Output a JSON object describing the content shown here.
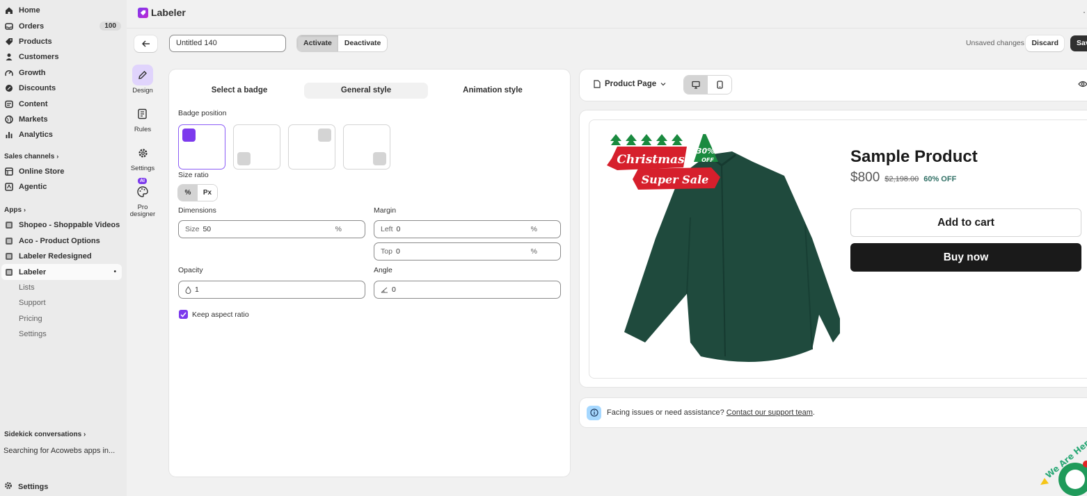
{
  "sidebar": {
    "items": [
      {
        "label": "Home",
        "icon": "home-icon"
      },
      {
        "label": "Orders",
        "icon": "orders-icon",
        "badge": "100"
      },
      {
        "label": "Products",
        "icon": "tag-icon"
      },
      {
        "label": "Customers",
        "icon": "person-icon"
      },
      {
        "label": "Growth",
        "icon": "growth-icon"
      },
      {
        "label": "Discounts",
        "icon": "discount-icon"
      },
      {
        "label": "Content",
        "icon": "content-icon"
      },
      {
        "label": "Markets",
        "icon": "globe-icon"
      },
      {
        "label": "Analytics",
        "icon": "chart-icon"
      }
    ],
    "sales_channels_label": "Sales channels",
    "channels": [
      {
        "label": "Online Store",
        "icon": "store-icon"
      },
      {
        "label": "Agentic",
        "icon": "agentic-icon"
      }
    ],
    "apps_label": "Apps",
    "apps": [
      {
        "label": "Shopeo - Shoppable Videos"
      },
      {
        "label": "Aco - Product Options"
      },
      {
        "label": "Labeler Redesigned"
      },
      {
        "label": "Labeler"
      }
    ],
    "labeler_sub": [
      "Lists",
      "Support",
      "Pricing",
      "Settings"
    ],
    "sidekick_title": "Sidekick conversations",
    "sidekick_item": "Searching for Acowebs apps in...",
    "settings_label": "Settings"
  },
  "header": {
    "app_title": "Labeler",
    "badge_name": "Untitled 140",
    "activate_label": "Activate",
    "deactivate_label": "Deactivate",
    "unsaved_label": "Unsaved changes",
    "discard_label": "Discard",
    "save_label": "Save"
  },
  "rail": {
    "design": "Design",
    "rules": "Rules",
    "settings": "Settings",
    "pro_line1": "Pro",
    "pro_line2": "designer",
    "ai_tag": "AI"
  },
  "editor": {
    "tabs": [
      "Select a badge",
      "General style",
      "Animation style"
    ],
    "selected_tab": 1,
    "badge_position_label": "Badge position",
    "size_ratio_label": "Size ratio",
    "size_ratio_options": [
      "%",
      "Px"
    ],
    "dimensions_label": "Dimensions",
    "size_prefix": "Size",
    "size_value": "50",
    "size_unit": "%",
    "margin_label": "Margin",
    "left_prefix": "Left",
    "left_value": "0",
    "top_prefix": "Top",
    "top_value": "0",
    "margin_unit": "%",
    "opacity_label": "Opacity",
    "opacity_value": "1",
    "angle_label": "Angle",
    "angle_value": "0",
    "keep_aspect_label": "Keep aspect ratio"
  },
  "preview": {
    "page_select": "Product Page",
    "badge_text": {
      "christmas": "Christmas",
      "super_sale": "Super Sale",
      "percent": "30%",
      "off": "OFF"
    },
    "product_title": "Sample Product",
    "price": "$800",
    "compare_price": "$2,198.00",
    "discount": "60% OFF",
    "add_to_cart": "Add to cart",
    "buy_now": "Buy now"
  },
  "help": {
    "text": "Facing issues or need assistance?",
    "link": "Contact our support team",
    "period": "."
  },
  "chat_widget_text": "We Are Here",
  "colors": {
    "accent": "#7c3aed",
    "shirt": "#1f4a3d",
    "banner_red": "#d61f2c",
    "tree_green": "#1a8a3f"
  }
}
